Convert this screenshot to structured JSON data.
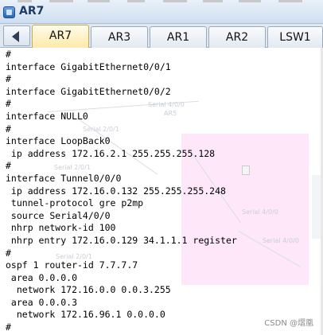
{
  "window": {
    "title": "AR7"
  },
  "tabs": [
    {
      "label": "AR7",
      "active": true
    },
    {
      "label": "AR3",
      "active": false
    },
    {
      "label": "AR1",
      "active": false
    },
    {
      "label": "AR2",
      "active": false
    },
    {
      "label": "LSW1",
      "active": false
    }
  ],
  "console": {
    "lines": [
      "#",
      "interface GigabitEthernet0/0/1",
      "#",
      "interface GigabitEthernet0/0/2",
      "#",
      "interface NULL0",
      "#",
      "interface LoopBack0",
      " ip address 172.16.2.1 255.255.255.128",
      "#",
      "interface Tunnel0/0/0",
      " ip address 172.16.0.132 255.255.255.248",
      " tunnel-protocol gre p2mp",
      " source Serial4/0/0",
      " nhrp network-id 100",
      " nhrp entry 172.16.0.129 34.1.1.1 register",
      "#",
      "ospf 1 router-id 7.7.7.7",
      " area 0.0.0.0",
      "  network 172.16.0.0 0.0.3.255",
      " area 0.0.0.3",
      "  network 172.16.96.1 0.0.0.0",
      "#"
    ]
  },
  "background_topology": {
    "labels": [
      "Serial 4/0/0",
      "AR5",
      "Serial 2/0/1",
      "Serial 2/0/1",
      "Serial 2/0/1",
      "Serial 4/0/0",
      "Serial 4/0/0"
    ]
  },
  "watermark": "CSDN @熠凰",
  "colors": {
    "tab_active": "#fde9a8",
    "tab_inactive": "#e3e9f1",
    "titlebar": "#cfdff0",
    "overlay_pink": "#fcdff6"
  }
}
